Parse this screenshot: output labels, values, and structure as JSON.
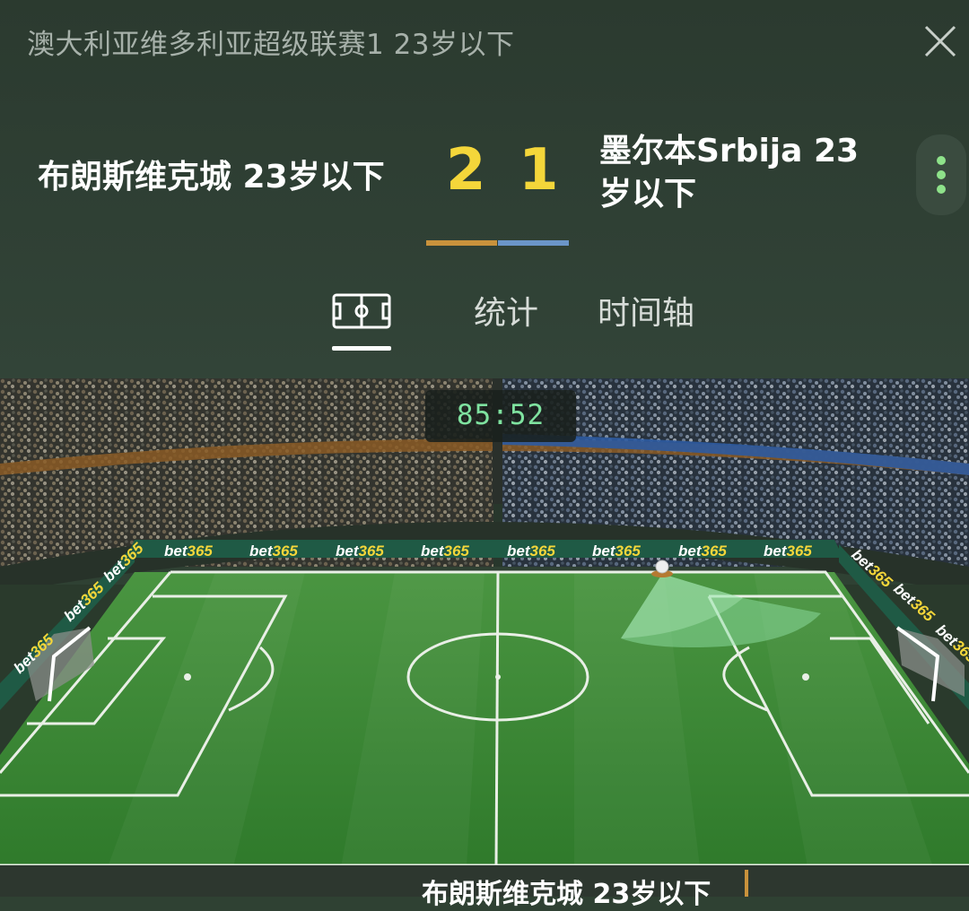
{
  "header": {
    "league_title": "澳大利亚维多利亚超级联赛1 23岁以下",
    "close_icon": "close-icon",
    "more_icon": "more-vertical-icon"
  },
  "match": {
    "home_team": "布朗斯维克城 23岁以下",
    "away_team": "墨尔本Srbija 23 岁以下",
    "home_score": "2",
    "away_score": "1",
    "home_color": "#c9923c",
    "away_color": "#6b95c8"
  },
  "tabs": [
    {
      "id": "pitch",
      "icon": "pitch-icon",
      "label": "",
      "active": true
    },
    {
      "id": "stats",
      "label": "统计",
      "active": false
    },
    {
      "id": "timeline",
      "label": "时间轴",
      "active": false
    }
  ],
  "live": {
    "clock": "85:52",
    "ad_board_text": "bet365",
    "ball_icon": "ball-icon",
    "bottom_team": "布朗斯维克城 23岁以下"
  },
  "colors": {
    "score": "#f4d63a",
    "clock": "#7fe3a0",
    "pitch_light": "#4f9a43",
    "pitch_dark": "#3f8436",
    "more_dots": "#8ee28a"
  }
}
